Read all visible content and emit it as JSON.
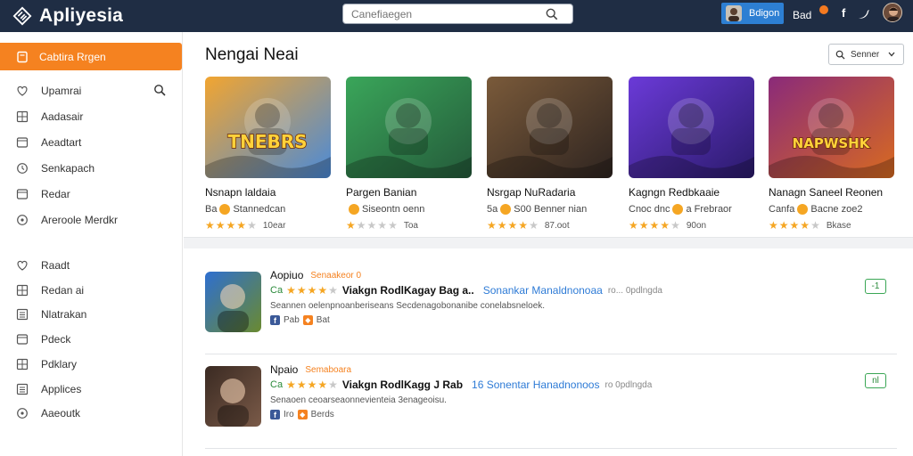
{
  "header": {
    "app_name": "Apliyesia",
    "search_placeholder": "Canefiaegen",
    "user_label": "Bdigon",
    "link_label": "Bad"
  },
  "sidebar": {
    "active": {
      "label": "Cabtira Rrgen",
      "icon": "bookmark-icon"
    },
    "group1": [
      {
        "label": "Upamrai",
        "icon": "heart-icon"
      },
      {
        "label": "Aadasair",
        "icon": "grid-icon"
      },
      {
        "label": "Aeadtart",
        "icon": "window-icon"
      },
      {
        "label": "Senkapach",
        "icon": "clock-icon"
      },
      {
        "label": "Redar",
        "icon": "window-icon"
      },
      {
        "label": "Areroole Merdkr",
        "icon": "circle-icon"
      }
    ],
    "group2": [
      {
        "label": "Raadt",
        "icon": "heart-icon"
      },
      {
        "label": "Redan ai",
        "icon": "grid-icon"
      },
      {
        "label": "Nlatrakan",
        "icon": "list-icon"
      },
      {
        "label": "Pdeck",
        "icon": "window-icon"
      },
      {
        "label": "Pdklary",
        "icon": "grid-icon"
      },
      {
        "label": "Applices",
        "icon": "list-icon"
      },
      {
        "label": "Aaeoutk",
        "icon": "circle-icon"
      }
    ]
  },
  "main": {
    "section_title": "Nengai Neai",
    "sort_label": "Senner",
    "cards": [
      {
        "title": "Nsnapn laldaia",
        "sub_left": "Ba",
        "sub_right": "Stannedcan",
        "rating": 4,
        "count": "10ear",
        "banner": "TNEBRS",
        "colors": [
          "#f2a530",
          "#4a8ad8"
        ]
      },
      {
        "title": "Pargen Banian",
        "sub_left": "",
        "sub_right": "Siseontn oenn",
        "rating": 1,
        "count": "Toa",
        "banner": "",
        "colors": [
          "#3aa65a",
          "#245a3a"
        ]
      },
      {
        "title": "Nsrgap NuRadaria",
        "sub_left": "5a",
        "sub_right": "S00 Benner nian",
        "rating": 4,
        "count": "87.oot",
        "banner": "",
        "colors": [
          "#7a5a3a",
          "#2e2420"
        ]
      },
      {
        "title": "Kagngn Redbkaaie",
        "sub_left": "Cnoc dnc",
        "sub_right": "a Frebraor",
        "rating": 4,
        "count": "90on",
        "banner": "",
        "colors": [
          "#6b3ad8",
          "#2a1a6a"
        ]
      },
      {
        "title": "Nanagn Saneel Reonen",
        "sub_left": "Canfa",
        "sub_right": "Bacne zoe2",
        "rating": 4,
        "count": "Bkase",
        "banner": "NAPWSHK",
        "colors": [
          "#8a2a7a",
          "#d86a20"
        ]
      }
    ],
    "list": [
      {
        "name": "Aopiuo",
        "dev": "Senaakeor 0",
        "tag": "Ca",
        "rating": 4,
        "title": "Viakgn RodlKagay Bag a..",
        "link": "Sonankar Manaldnonoaa",
        "meta": "ro... 0pdlngda",
        "desc": "Seannen oelenpnoanberiseans Secdenagobonanibe conelabsneloek.",
        "foot_left": "Pab",
        "foot_mid": "Bat",
        "button": "-1",
        "thumb_colors": [
          "#2e6fd0",
          "#6a8a30"
        ]
      },
      {
        "name": "Npaio",
        "dev": "Semaboara",
        "tag": "Ca",
        "rating": 4,
        "title": "Viakgn RodlKagg J Rab",
        "link": "16 Sonentar Hanadnonoos",
        "meta": "ro 0pdlngda",
        "desc": "Senaoen ceoarseaonnevienteia 3enageoisu.",
        "foot_left": "Iro",
        "foot_mid": "Berds",
        "button": "nl",
        "thumb_colors": [
          "#3a2a22",
          "#7a5a48"
        ]
      }
    ]
  },
  "colors": {
    "accent": "#f58220",
    "topbar": "#1f2d44",
    "link": "#2e7bd6",
    "green": "#3aa655"
  }
}
